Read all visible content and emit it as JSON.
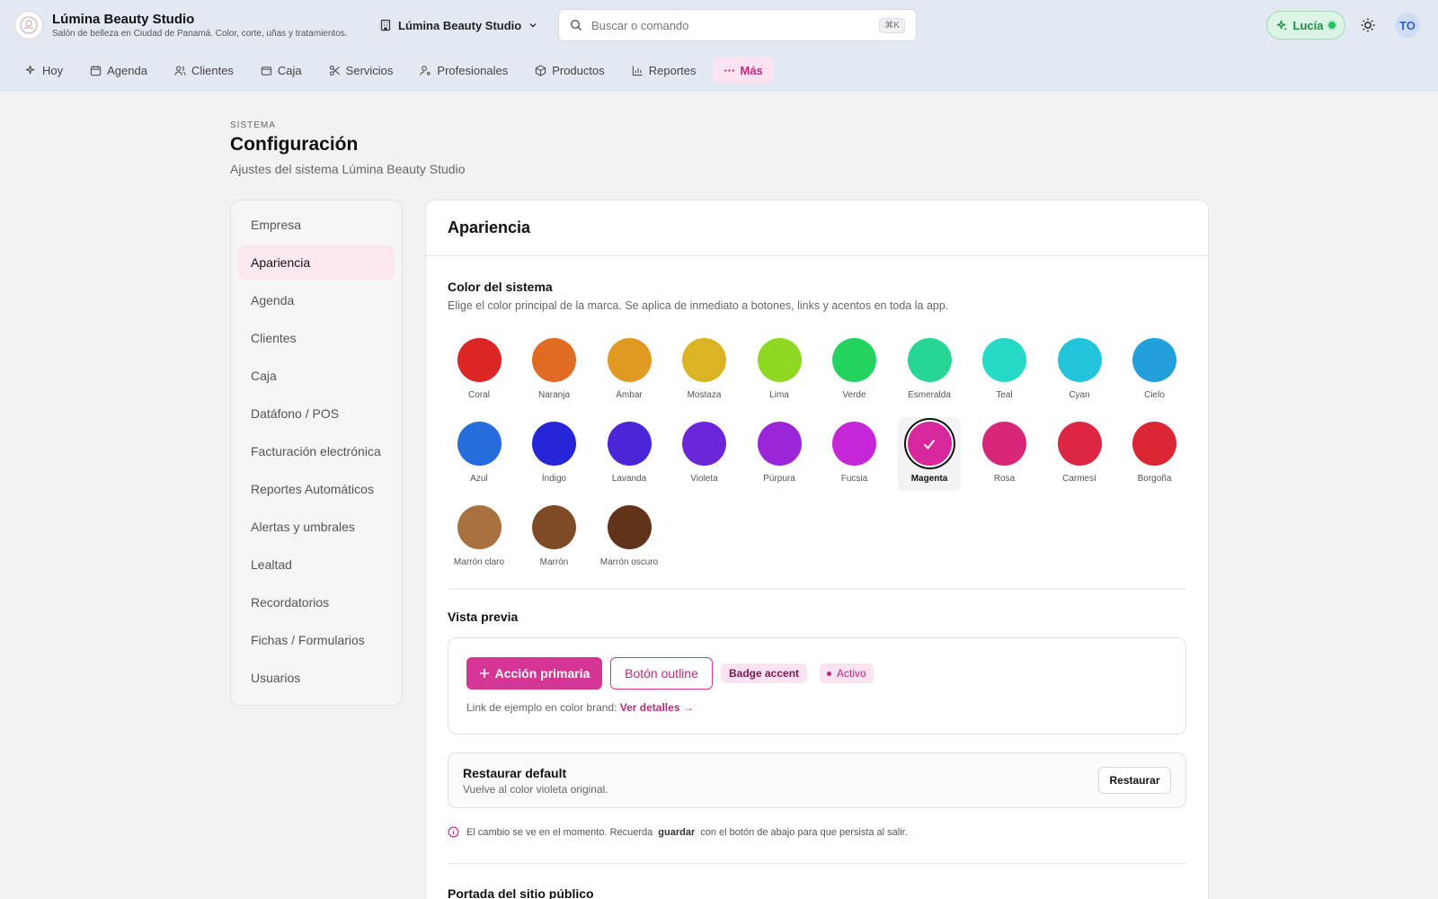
{
  "header": {
    "brand_title": "Lúmina Beauty Studio",
    "brand_subtitle": "Salón de belleza en Ciudad de Panamá. Color, corte, uñas y tratamientos.",
    "studio_selector": "Lúmina Beauty Studio",
    "search_placeholder": "Buscar o comando",
    "search_shortcut": "⌘K",
    "assistant_label": "Lucía",
    "avatar_initials": "TO"
  },
  "nav": [
    {
      "label": "Hoy",
      "icon": "sparkles-icon"
    },
    {
      "label": "Agenda",
      "icon": "calendar-icon"
    },
    {
      "label": "Clientes",
      "icon": "users-icon"
    },
    {
      "label": "Caja",
      "icon": "wallet-icon"
    },
    {
      "label": "Servicios",
      "icon": "scissors-icon"
    },
    {
      "label": "Profesionales",
      "icon": "user-cog-icon"
    },
    {
      "label": "Productos",
      "icon": "package-icon"
    },
    {
      "label": "Reportes",
      "icon": "bar-chart-icon"
    },
    {
      "label": "Más",
      "icon": "more-horizontal-icon",
      "active": true
    }
  ],
  "page": {
    "eyebrow": "SISTEMA",
    "title": "Configuración",
    "subtitle": "Ajustes del sistema Lúmina Beauty Studio"
  },
  "settings_menu": [
    {
      "label": "Empresa"
    },
    {
      "label": "Apariencia",
      "active": true
    },
    {
      "label": "Agenda"
    },
    {
      "label": "Clientes"
    },
    {
      "label": "Caja"
    },
    {
      "label": "Datáfono / POS"
    },
    {
      "label": "Facturación electrónica"
    },
    {
      "label": "Reportes Automáticos"
    },
    {
      "label": "Alertas y umbrales"
    },
    {
      "label": "Lealtad"
    },
    {
      "label": "Recordatorios"
    },
    {
      "label": "Fichas / Formularios"
    },
    {
      "label": "Usuarios"
    }
  ],
  "appearance": {
    "title": "Apariencia",
    "color_section_title": "Color del sistema",
    "color_section_desc": "Elige el color principal de la marca. Se aplica de inmediato a botones, links y acentos en toda la app.",
    "selected_color": "Magenta",
    "colors": [
      {
        "name": "Coral",
        "hex": "#dc2626"
      },
      {
        "name": "Naranja",
        "hex": "#e06b22"
      },
      {
        "name": "Ámbar",
        "hex": "#e09a22"
      },
      {
        "name": "Mostaza",
        "hex": "#dcb322"
      },
      {
        "name": "Lima",
        "hex": "#8fd822"
      },
      {
        "name": "Verde",
        "hex": "#22d35e"
      },
      {
        "name": "Esmeralda",
        "hex": "#27d694"
      },
      {
        "name": "Teal",
        "hex": "#26d8c6"
      },
      {
        "name": "Cyan",
        "hex": "#22c4dc"
      },
      {
        "name": "Cielo",
        "hex": "#22a0dc"
      },
      {
        "name": "Azul",
        "hex": "#266cdc"
      },
      {
        "name": "Índigo",
        "hex": "#2626d8"
      },
      {
        "name": "Lavanda",
        "hex": "#4a26d8"
      },
      {
        "name": "Violeta",
        "hex": "#6a26d8"
      },
      {
        "name": "Púrpura",
        "hex": "#9a26d8"
      },
      {
        "name": "Fucsia",
        "hex": "#c426d8"
      },
      {
        "name": "Magenta",
        "hex": "#d8269c"
      },
      {
        "name": "Rosa",
        "hex": "#d8267a"
      },
      {
        "name": "Carmesí",
        "hex": "#dc2643"
      },
      {
        "name": "Borgoña",
        "hex": "#dc2634"
      },
      {
        "name": "Marrón claro",
        "hex": "#a8713e"
      },
      {
        "name": "Marrón",
        "hex": "#7f4a26"
      },
      {
        "name": "Marrón oscuro",
        "hex": "#61331b"
      }
    ],
    "preview_title": "Vista previa",
    "preview_primary": "Acción primaria",
    "preview_outline": "Botón outline",
    "preview_badge": "Badge accent",
    "preview_status": "Activo",
    "preview_link_prefix": "Link de ejemplo en color brand:",
    "preview_link": "Ver detalles →",
    "restore_title": "Restaurar default",
    "restore_desc": "Vuelve al color violeta original.",
    "restore_button": "Restaurar",
    "note_before": "El cambio se ve en el momento. Recuerda",
    "note_bold": "guardar",
    "note_after": "con el botón de abajo para que persista al salir.",
    "next_section_title": "Portada del sitio público"
  },
  "theme": {
    "accent": "#d63595",
    "accent_soft": "#fbe3f2"
  }
}
